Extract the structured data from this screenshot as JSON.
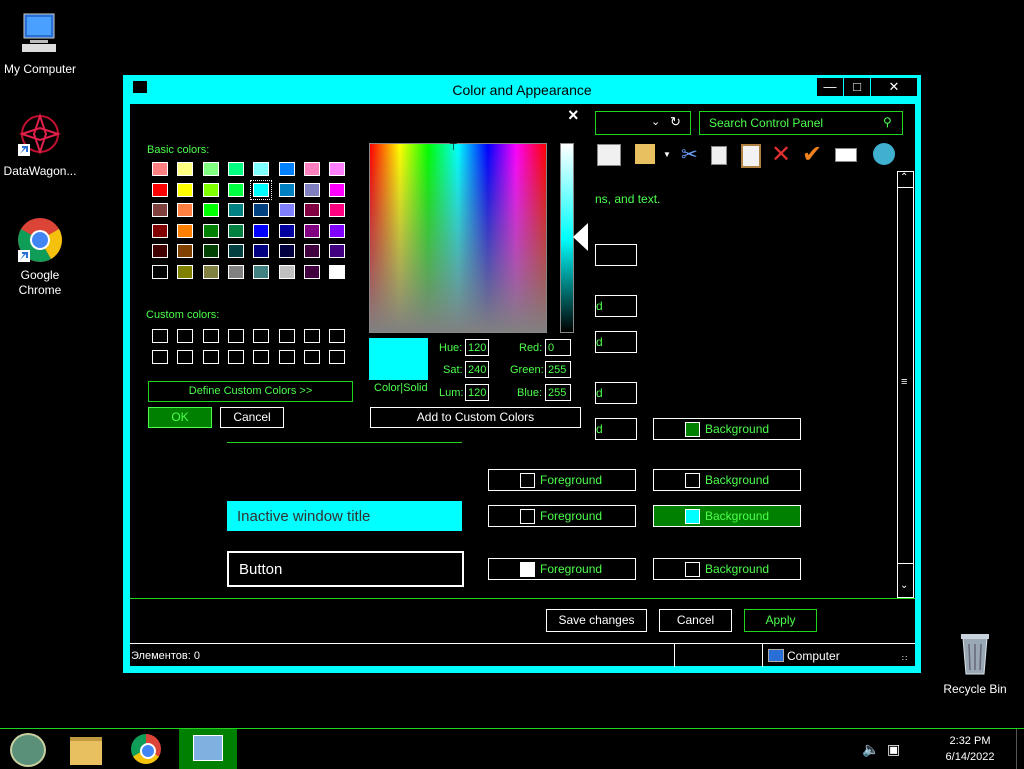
{
  "desktop": {
    "icons": [
      {
        "label": "My Computer"
      },
      {
        "label": "DataWagon..."
      },
      {
        "label": "Google Chrome"
      },
      {
        "label": "Recycle Bin"
      }
    ]
  },
  "window": {
    "title": "Color and Appearance",
    "search_placeholder": "Search Control Panel",
    "desc_text": "ns, and text.",
    "partial_label": "d",
    "rows": [
      {
        "fg": "Foreground",
        "bg": "Background"
      },
      {
        "fg": "Foreground",
        "bg": "Background"
      },
      {
        "fg": "Foreground",
        "bg": "Background"
      }
    ],
    "bg_row1": "Background",
    "inactive_title": "Inactive window title",
    "button_preview": "Button",
    "save_label": "Save changes",
    "cancel_label": "Cancel",
    "apply_label": "Apply",
    "status_left": "Элементов: 0",
    "status_right": "Computer"
  },
  "color_dialog": {
    "basic_label": "Basic colors:",
    "custom_label": "Custom colors:",
    "define_label": "Define Custom Colors >>",
    "ok_label": "OK",
    "cancel_label": "Cancel",
    "add_label": "Add to Custom Colors",
    "colorsolid_label": "Color|Solid",
    "hue_label": "Hue:",
    "hue": "120",
    "sat_label": "Sat:",
    "sat": "240",
    "lum_label": "Lum:",
    "lum": "120",
    "red_label": "Red:",
    "red": "0",
    "green_label": "Green:",
    "green": "255",
    "blue_label": "Blue:",
    "blue": "255",
    "close_glyph": "×",
    "basic_colors": [
      "#ff8080",
      "#ffff80",
      "#80ff80",
      "#00ff80",
      "#80ffff",
      "#0080ff",
      "#ff80c0",
      "#ff80ff",
      "#ff0000",
      "#ffff00",
      "#80ff00",
      "#00ff40",
      "#00ffff",
      "#0080c0",
      "#8080c0",
      "#ff00ff",
      "#804040",
      "#ff8040",
      "#00ff00",
      "#008080",
      "#004080",
      "#8080ff",
      "#800040",
      "#ff0080",
      "#800000",
      "#ff8000",
      "#008000",
      "#008040",
      "#0000ff",
      "#0000a0",
      "#800080",
      "#8000ff",
      "#400000",
      "#804000",
      "#004000",
      "#004040",
      "#000080",
      "#000040",
      "#400040",
      "#400080",
      "#000000",
      "#808000",
      "#808040",
      "#808080",
      "#408080",
      "#c0c0c0",
      "#400040",
      "#ffffff"
    ],
    "selected_color": "#00ffff"
  },
  "taskbar": {
    "time": "2:32 PM",
    "date": "6/14/2022"
  },
  "colors": {
    "accent": "#00ffff",
    "text_green": "#4cff4c",
    "border_green": "#1fd51f",
    "active_green": "#008000"
  }
}
